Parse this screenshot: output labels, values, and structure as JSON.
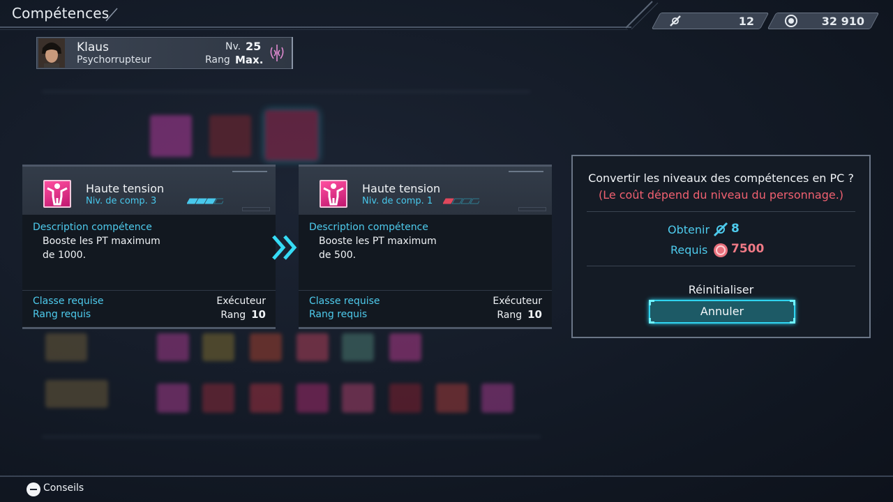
{
  "header": {
    "title": "Compétences",
    "currency1": {
      "icon": "skill-point-icon",
      "value": "12"
    },
    "currency2": {
      "icon": "coin-icon",
      "value": "32 910"
    }
  },
  "character": {
    "name": "Klaus",
    "class": "Psychorrupteur",
    "level_label": "Nv.",
    "level": "25",
    "rank_label": "Rang",
    "rank": "Max."
  },
  "current_skill": {
    "name": "Haute tension",
    "level_text": "Niv. de comp. 3",
    "level_filled": 3,
    "level_max": 4,
    "desc_label": "Description compétence",
    "desc_line1": "Booste les PT maximum",
    "desc_line2": "de 1000.",
    "class_label": "Classe requise",
    "class_value": "Exécuteur",
    "rank_label": "Rang requis",
    "rank_word": "Rang",
    "rank_value": "10"
  },
  "new_skill": {
    "name": "Haute tension",
    "level_text": "Niv. de comp. 1",
    "level_filled": 1,
    "level_max": 4,
    "desc_label": "Description compétence",
    "desc_line1": "Booste les PT maximum",
    "desc_line2": "de 500.",
    "class_label": "Classe requise",
    "class_value": "Exécuteur",
    "rank_label": "Rang requis",
    "rank_word": "Rang",
    "rank_value": "10"
  },
  "dialog": {
    "question": "Convertir les niveaux des compétences en PC ?",
    "note": "(Le coût dépend du niveau du personnage.)",
    "obtain_label": "Obtenir",
    "obtain_value": "8",
    "required_label": "Requis",
    "required_value": "7500",
    "reset_option": "Réinitialiser",
    "cancel_option": "Annuler"
  },
  "footer": {
    "hint_label": "Conseils"
  },
  "colors": {
    "accent_cyan": "#4ecbed",
    "warning_red": "#f06070",
    "skill_pink": "#ff4fa0",
    "button_highlight": "#2fd4f0"
  }
}
